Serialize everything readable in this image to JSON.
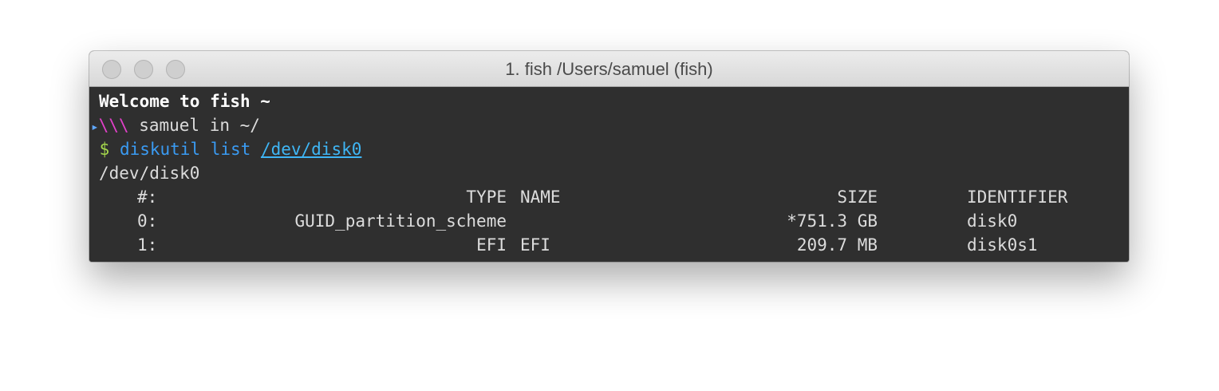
{
  "window": {
    "title": "1. fish  /Users/samuel (fish)"
  },
  "terminal": {
    "welcome": "Welcome to fish ~",
    "prompt": {
      "arrow": "▸",
      "backslashes": "\\\\\\",
      "user_dir": " samuel in ~/"
    },
    "command": {
      "dollar": " $ ",
      "cmd": "diskutil list ",
      "path": "/dev/disk0"
    },
    "device": "/dev/disk0",
    "table": {
      "headers": {
        "num": "#:",
        "type": "TYPE",
        "name": "NAME",
        "size": "SIZE",
        "identifier": "IDENTIFIER"
      },
      "rows": [
        {
          "num": "0:",
          "type": "GUID_partition_scheme",
          "name": "",
          "size": "*751.3 GB",
          "identifier": "disk0"
        },
        {
          "num": "1:",
          "type": "EFI",
          "name": "EFI",
          "size": "209.7 MB",
          "identifier": "disk0s1"
        }
      ]
    }
  },
  "colors": {
    "highlight_border": "#e03a37",
    "terminal_bg": "#2f2f2f",
    "command": "#3a9bf3",
    "prompt_slashes": "#e040c8",
    "dollar": "#a6d94c"
  }
}
